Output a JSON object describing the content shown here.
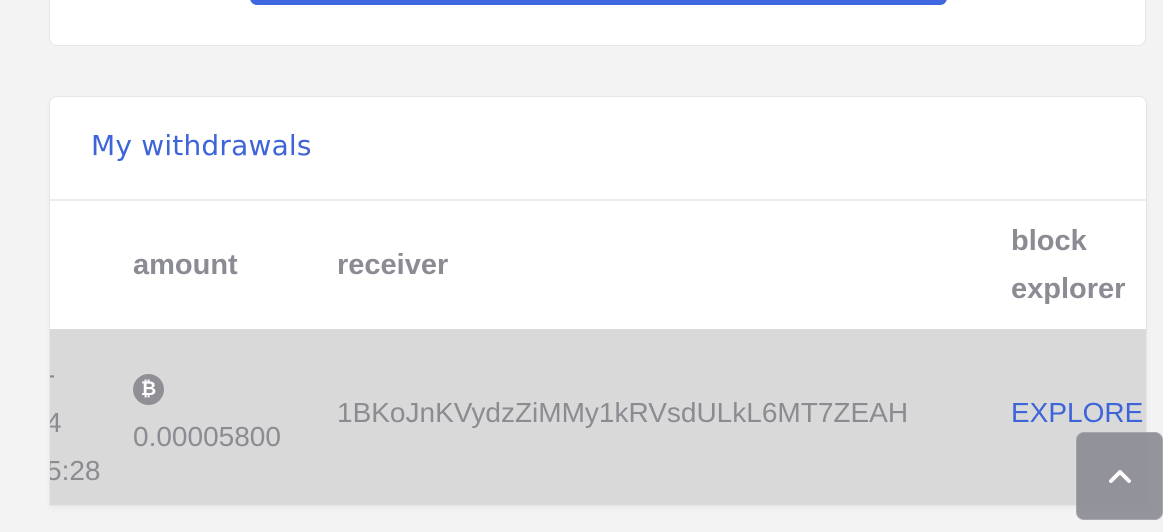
{
  "withdrawals": {
    "title": "My withdrawals",
    "columns": {
      "amount": "amount",
      "receiver": "receiver",
      "block_explorer_line1": "block",
      "block_explorer_line2": "explorer"
    },
    "rows": [
      {
        "date_fragments": [
          "-",
          "4",
          "5:28"
        ],
        "coin_icon": "bitcoin-icon",
        "coin_glyph": "₿",
        "amount": "0.00005800",
        "receiver": "1BKoJnKVydzZiMMy1kRVsdULkL6MT7ZEAH",
        "explore_label": "EXPLORE"
      }
    ]
  },
  "colors": {
    "accent": "#3d64d8",
    "button_blue": "#3f68e0",
    "row_highlight": "#d9d9d9",
    "muted_text": "#8b8b94"
  },
  "scroll_top": {
    "icon": "chevron-up-icon"
  }
}
